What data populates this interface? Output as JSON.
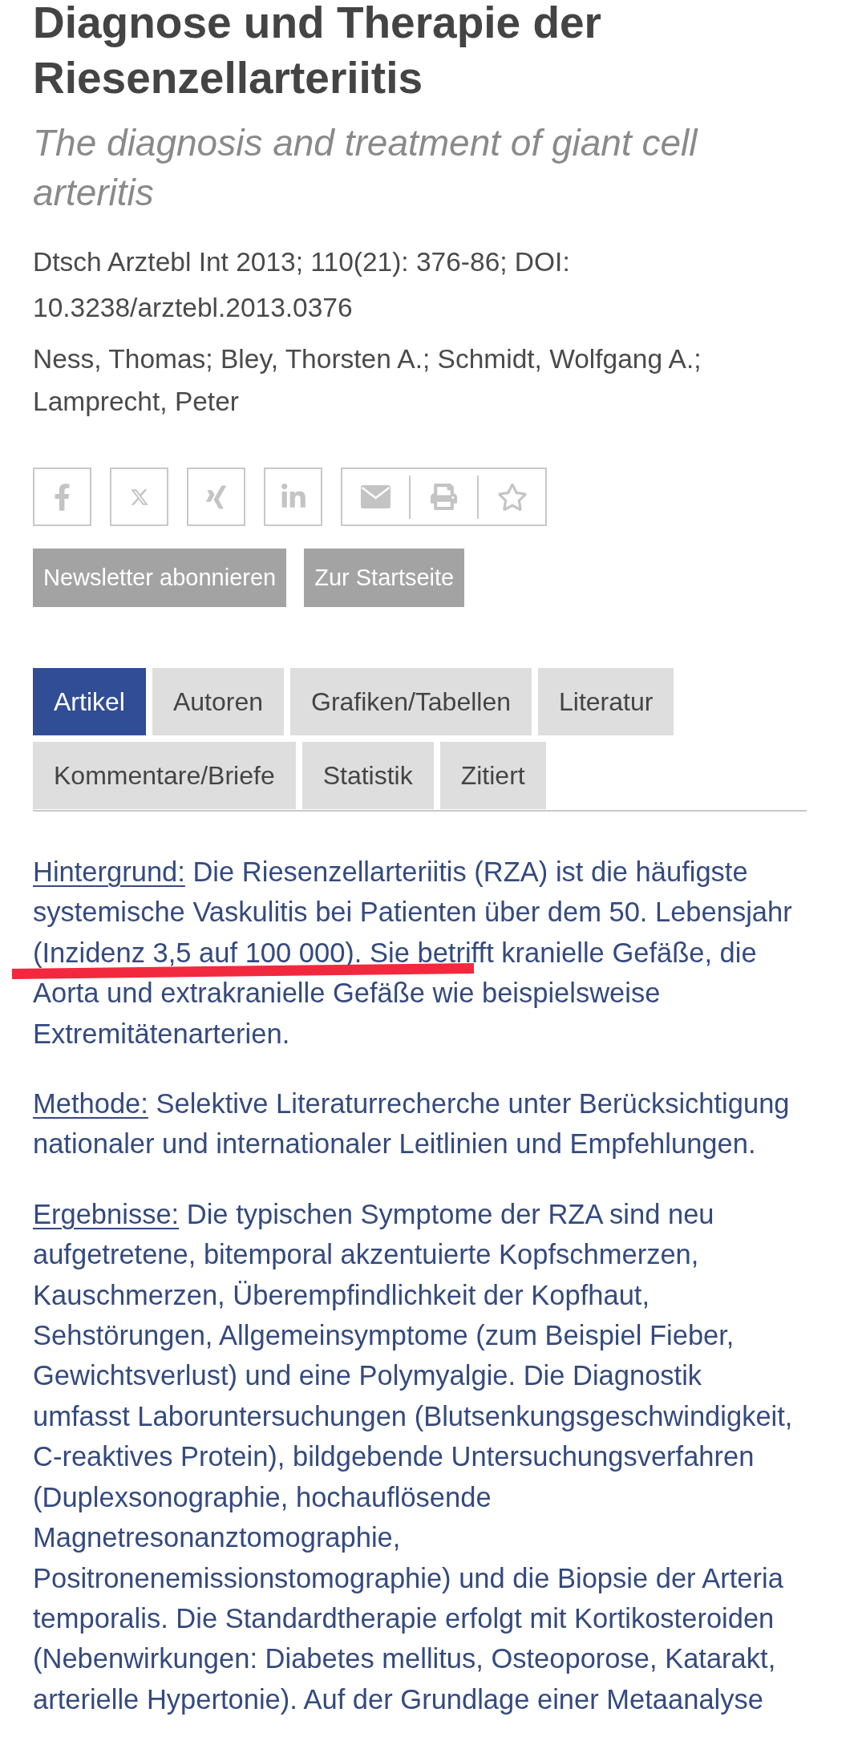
{
  "article": {
    "title": "Diagnose und Therapie der Riesenzellarteriitis",
    "subtitle": "The diagnosis and treatment of giant cell arteritis",
    "citation": "Dtsch Arztebl Int 2013; 110(21): 376-86; DOI: 10.3238/arztebl.2013.0376",
    "authors": "Ness, Thomas; Bley, Thorsten A.; Schmidt, Wolfgang A.; Lamprecht, Peter"
  },
  "share_buttons": [
    {
      "kind": "facebook"
    },
    {
      "kind": "x"
    },
    {
      "kind": "xing"
    },
    {
      "kind": "linkedin"
    }
  ],
  "share_tools": [
    {
      "kind": "email"
    },
    {
      "kind": "print"
    },
    {
      "kind": "bookmark"
    }
  ],
  "action_buttons": [
    {
      "label": "Newsletter abonnieren"
    },
    {
      "label": "Zur Startseite"
    }
  ],
  "tabs": [
    {
      "label": "Artikel",
      "selected": true
    },
    {
      "label": "Autoren",
      "selected": false
    },
    {
      "label": "Grafiken/Tabellen",
      "selected": false
    },
    {
      "label": "Literatur",
      "selected": false
    },
    {
      "label": "Kommentare/Briefe",
      "selected": false
    },
    {
      "label": "Statistik",
      "selected": false
    },
    {
      "label": "Zitiert",
      "selected": false
    }
  ],
  "abstract": [
    {
      "label": "Hintergrund:",
      "text": "Die Riesenzellarteriitis (RZA) ist die häufigste systemische Vaskulitis bei Patienten über dem 50. Lebensjahr (Inzidenz 3,5 auf 100 000). Sie betrifft kranielle Gefäße, die Aorta und extrakranielle Gefäße wie beispielsweise Extremitätenarterien.",
      "marked": true
    },
    {
      "label": "Methode:",
      "text": "Selektive Literaturrecherche unter Berücksichtigung nationaler und internationaler Leitlinien und Empfehlungen.",
      "marked": false
    },
    {
      "label": "Ergebnisse:",
      "text": "Die typischen Symptome der RZA sind neu aufgetretene, bitemporal akzentuierte Kopfschmerzen, Kauschmerzen, Überempfindlichkeit der Kopfhaut, Sehstörungen, Allgemeinsymptome (zum Beispiel Fieber, Gewichtsverlust) und eine Polymyalgie. Die Diagnostik umfasst Laboruntersuchungen (Blutsenkungsgeschwindigkeit, C-reaktives Protein), bildgebende Untersuchungsverfahren (Duplexsonographie, hochauflösende Magnetresonanztomographie, Positronenemissionstomographie) und die Biopsie der Arteria temporalis. Die Standardtherapie erfolgt mit Kortikosteroiden (Nebenwirkungen: Diabetes mellitus, Osteoporose, Katarakt, arterielle Hypertonie). Auf der Grundlage einer Metaanalyse",
      "marked": false
    }
  ]
}
